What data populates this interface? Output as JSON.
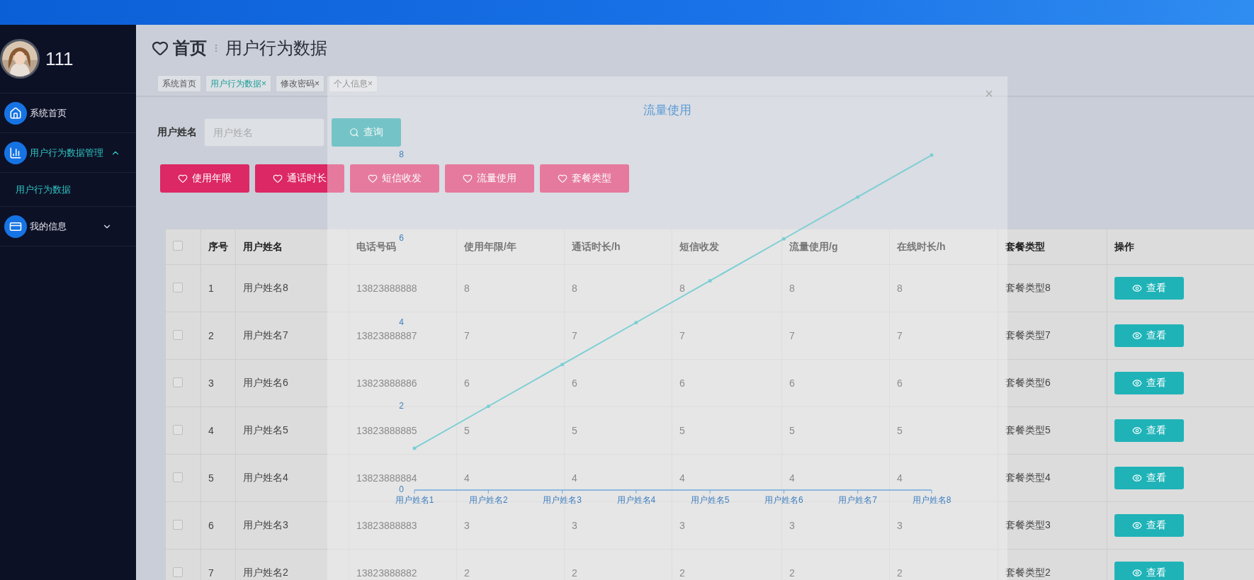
{
  "sidebar": {
    "user": {
      "name": "111"
    },
    "items": [
      {
        "label": "系统首页"
      },
      {
        "label": "用户行为数据管理",
        "expanded": true,
        "children": [
          {
            "label": "用户行为数据",
            "selected": true
          }
        ]
      },
      {
        "label": "我的信息",
        "expanded": false
      }
    ]
  },
  "breadcrumb": {
    "home": "首页",
    "current": "用户行为数据"
  },
  "tabs": [
    {
      "label": "系统首页",
      "selected": false
    },
    {
      "label": "用户行为数据",
      "selected": true,
      "close": "×"
    },
    {
      "label": "修改密码",
      "selected": false,
      "close": "×"
    },
    {
      "label": "个人信息",
      "selected": false,
      "close": "×"
    }
  ],
  "search": {
    "label": "用户姓名",
    "placeholder": "用户姓名",
    "button": "查询"
  },
  "chart_buttons": [
    "使用年限",
    "通话时长",
    "短信收发",
    "流量使用",
    "套餐类型"
  ],
  "table": {
    "all_checked": false,
    "columns": [
      "序号",
      "用户姓名",
      "电话号码",
      "使用年限/年",
      "通话时长/h",
      "短信收发",
      "流量使用/g",
      "在线时长/h",
      "套餐类型",
      "操作"
    ],
    "rows": [
      {
        "checked": false,
        "cells": [
          "1",
          "用户姓名8",
          "13823888888",
          "8",
          "8",
          "8",
          "8",
          "8",
          "套餐类型8"
        ],
        "action": "查看"
      },
      {
        "checked": false,
        "cells": [
          "2",
          "用户姓名7",
          "13823888887",
          "7",
          "7",
          "7",
          "7",
          "7",
          "套餐类型7"
        ],
        "action": "查看"
      },
      {
        "checked": false,
        "cells": [
          "3",
          "用户姓名6",
          "13823888886",
          "6",
          "6",
          "6",
          "6",
          "6",
          "套餐类型6"
        ],
        "action": "查看"
      },
      {
        "checked": false,
        "cells": [
          "4",
          "用户姓名5",
          "13823888885",
          "5",
          "5",
          "5",
          "5",
          "5",
          "套餐类型5"
        ],
        "action": "查看"
      },
      {
        "checked": false,
        "cells": [
          "5",
          "用户姓名4",
          "13823888884",
          "4",
          "4",
          "4",
          "4",
          "4",
          "套餐类型4"
        ],
        "action": "查看"
      },
      {
        "checked": false,
        "cells": [
          "6",
          "用户姓名3",
          "13823888883",
          "3",
          "3",
          "3",
          "3",
          "3",
          "套餐类型3"
        ],
        "action": "查看"
      },
      {
        "checked": false,
        "cells": [
          "7",
          "用户姓名2",
          "13823888882",
          "2",
          "2",
          "2",
          "2",
          "2",
          "套餐类型2"
        ],
        "action": "查看"
      }
    ]
  },
  "dialog": {
    "close": "×",
    "chart_data": {
      "type": "line",
      "title": "流量使用",
      "categories": [
        "用户姓名1",
        "用户姓名2",
        "用户姓名3",
        "用户姓名4",
        "用户姓名5",
        "用户姓名6",
        "用户姓名7",
        "用户姓名8"
      ],
      "series": [
        {
          "color": "#7ccfd4",
          "values": [
            1,
            2,
            3,
            4,
            5,
            6,
            7,
            8
          ]
        }
      ],
      "ylim": [
        0,
        8
      ],
      "yticks": [
        0,
        2,
        4,
        6,
        8
      ]
    }
  }
}
